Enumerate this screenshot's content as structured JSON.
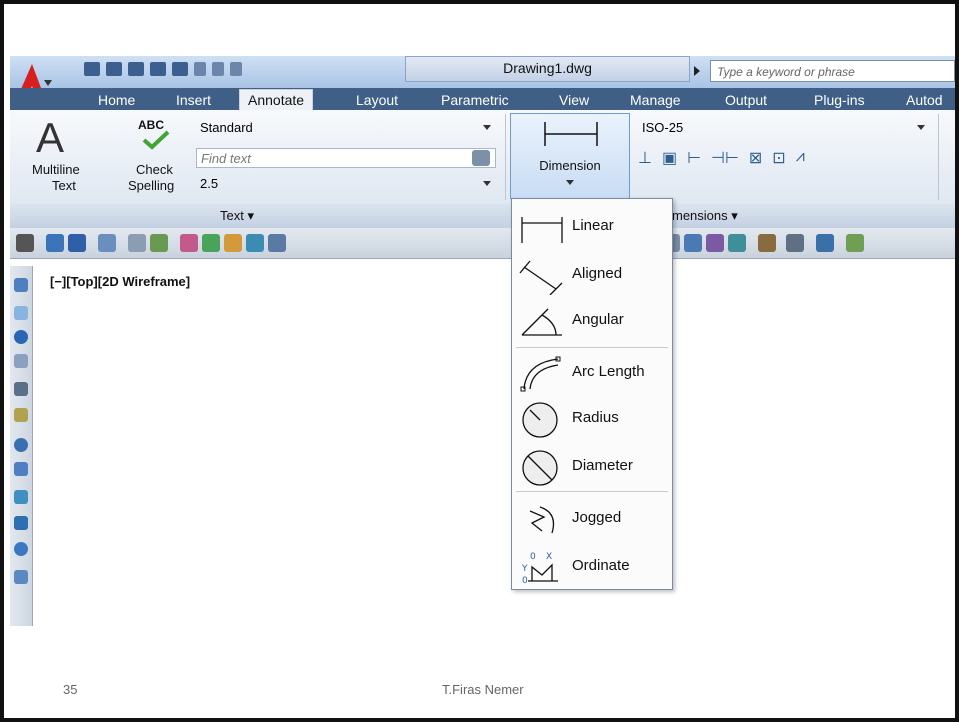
{
  "app": {
    "doc_title": "Drawing1.dwg",
    "search_placeholder": "Type a keyword or phrase"
  },
  "tabs": [
    "Home",
    "Insert",
    "Annotate",
    "Layout",
    "Parametric",
    "View",
    "Manage",
    "Output",
    "Plug-ins",
    "Autod"
  ],
  "active_tab": "Annotate",
  "text_panel": {
    "multiline_line1": "Multiline",
    "multiline_line2": "Text",
    "check_abc": "ABC",
    "check_line1": "Check",
    "check_line2": "Spelling",
    "style_value": "Standard",
    "find_placeholder": "Find text",
    "height_value": "2.5",
    "panel_label": "Text ▾"
  },
  "dim_panel": {
    "button_label": "Dimension",
    "style_value": "ISO-25",
    "panel_label": "mensions ▾"
  },
  "viewport": {
    "label": "[−][Top][2D Wireframe]"
  },
  "dropdown": {
    "items": [
      "Linear",
      "Aligned",
      "Angular",
      "Arc Length",
      "Radius",
      "Diameter",
      "Jogged",
      "Ordinate"
    ]
  },
  "slide": {
    "number": "35",
    "footer": "T.Firas Nemer"
  },
  "colors": {
    "tab_bar": "#3f5f86",
    "accent_red": "#d71f1f"
  }
}
